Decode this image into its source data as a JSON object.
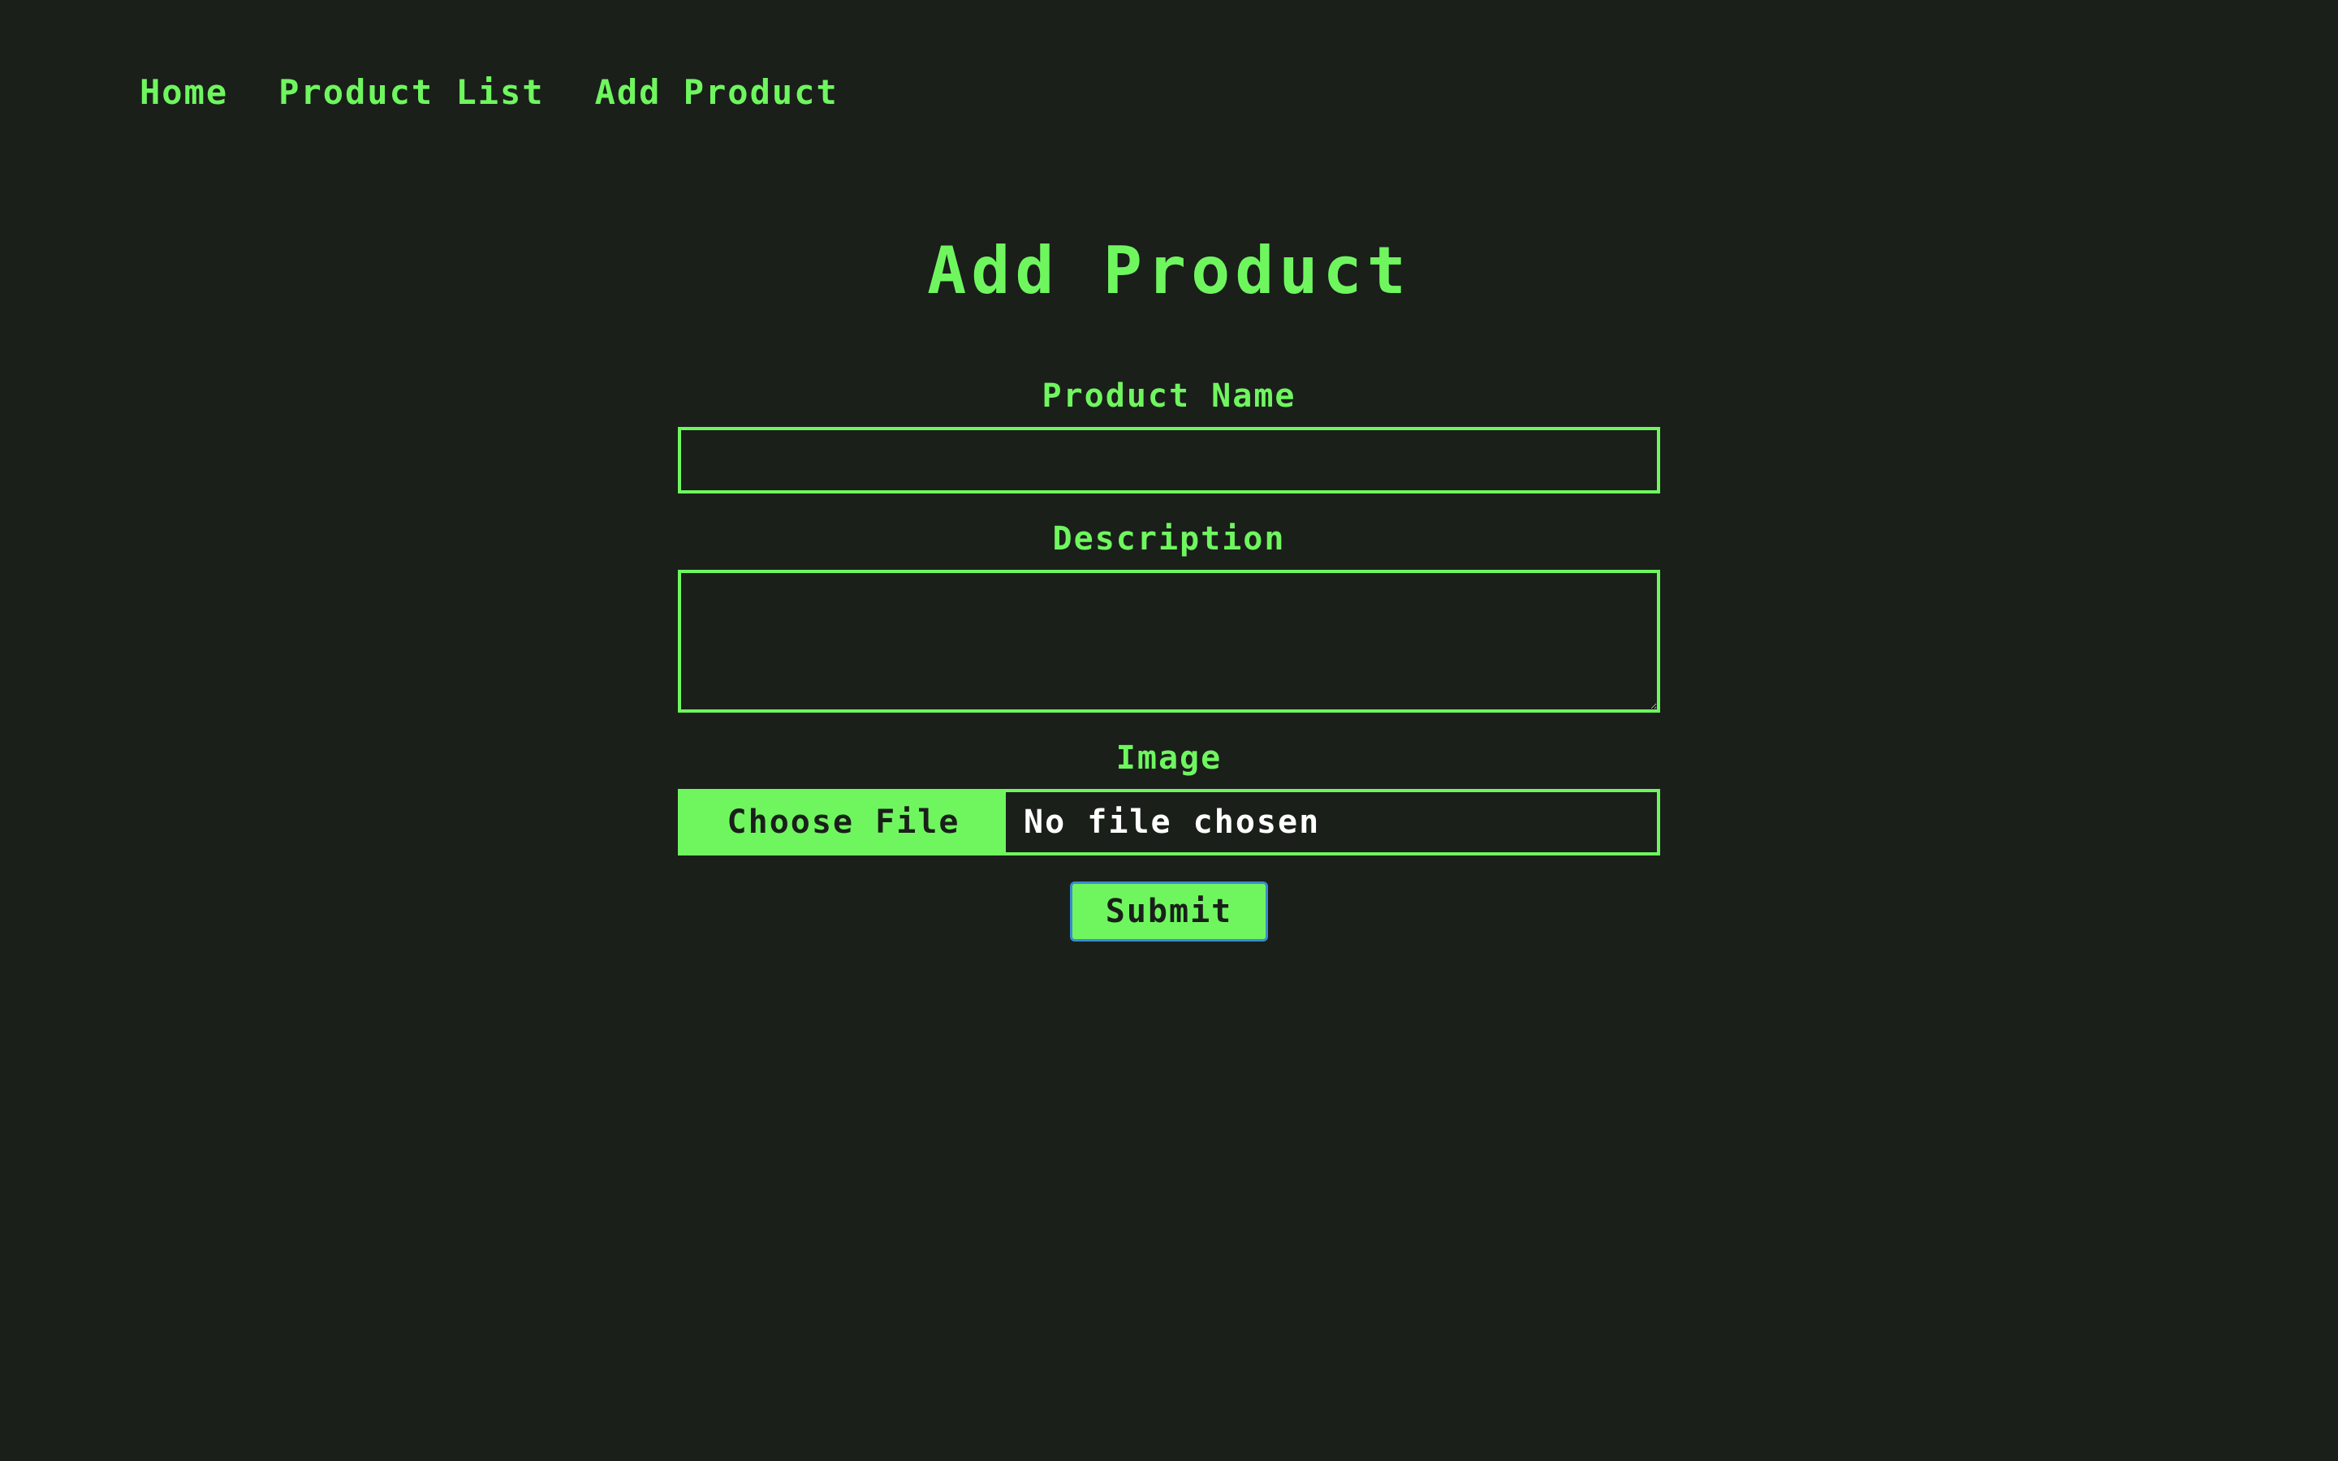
{
  "nav": {
    "items": [
      {
        "label": "Home"
      },
      {
        "label": "Product List"
      },
      {
        "label": "Add Product"
      }
    ]
  },
  "page": {
    "title": "Add Product"
  },
  "form": {
    "product_name": {
      "label": "Product Name",
      "value": "",
      "placeholder": ""
    },
    "description": {
      "label": "Description",
      "value": "",
      "placeholder": ""
    },
    "image": {
      "label": "Image",
      "button_label": "Choose File",
      "status": "No file chosen"
    },
    "submit_label": "Submit"
  },
  "colors": {
    "background": "#1a1f1a",
    "accent": "#6ff65f",
    "text_light": "#ffffff",
    "focus_ring": "#3a8ad0"
  }
}
